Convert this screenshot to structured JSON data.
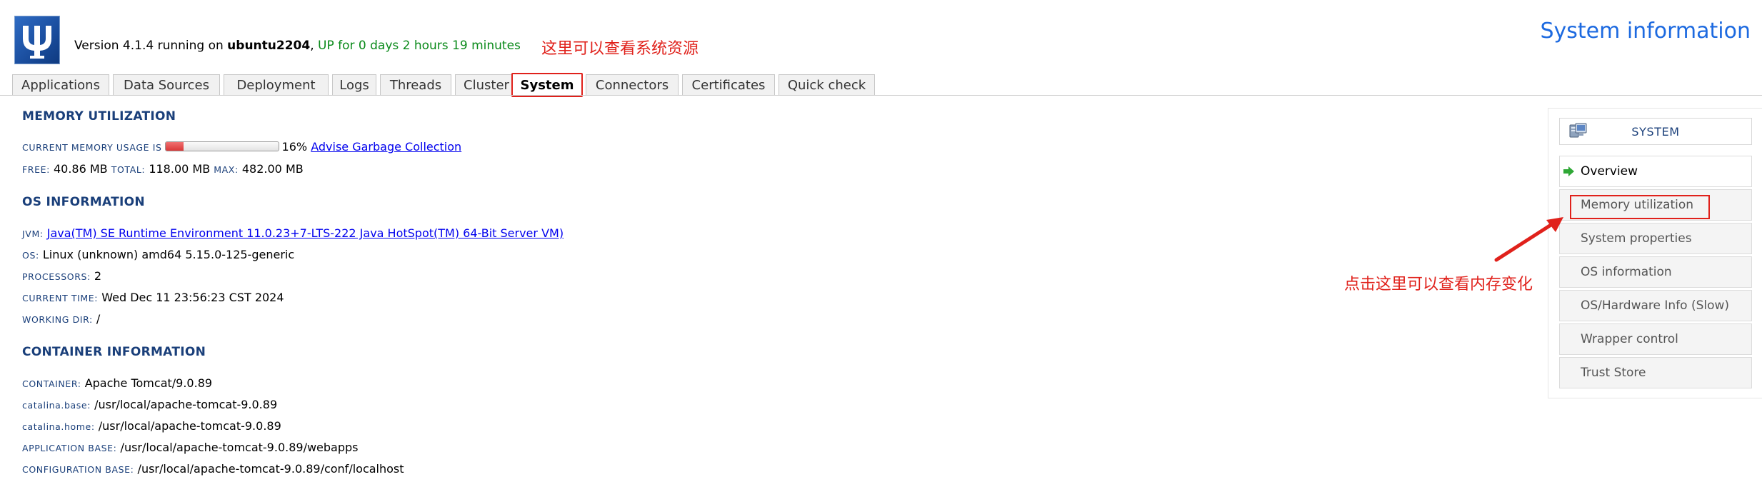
{
  "header": {
    "logo_icon": "psi-logo-icon",
    "version_prefix": "Version 4.1.4 running on ",
    "hostname": "ubuntu2204",
    "version_sep": ", ",
    "uptime": "UP for 0 days 2 hours 19 minutes",
    "page_title": "System information",
    "annotation": "这里可以查看系统资源"
  },
  "tabs": [
    {
      "label": "Applications"
    },
    {
      "label": "Data Sources"
    },
    {
      "label": "Deployment"
    },
    {
      "label": "Logs"
    },
    {
      "label": "Threads"
    },
    {
      "label": "Cluster"
    },
    {
      "label": "System",
      "active": true
    },
    {
      "label": "Connectors"
    },
    {
      "label": "Certificates"
    },
    {
      "label": "Quick check"
    }
  ],
  "memory": {
    "title": "MEMORY UTILIZATION",
    "current_label": "Current memory usage is",
    "percent_text": "16%",
    "percent_value": 0.16,
    "gc_link": "Advise Garbage Collection",
    "free_label": "Free:",
    "free_value": "40.86 MB",
    "total_label": "Total:",
    "total_value": "118.00 MB",
    "max_label": "Max:",
    "max_value": "482.00 MB"
  },
  "os": {
    "title": "OS INFORMATION",
    "jvm_label": "JVM:",
    "jvm_value": " Java(TM) SE Runtime Environment  11.0.23+7-LTS-222  Java HotSpot(TM) 64-Bit Server VM)",
    "os_label": "OS:",
    "os_value": "Linux (unknown) amd64 5.15.0-125-generic",
    "processors_label": "Processors:",
    "processors_value": "2",
    "time_label": "Current time:",
    "time_value": "Wed Dec 11 23:56:23 CST 2024",
    "workdir_label": "Working dir:",
    "workdir_value": "/"
  },
  "container": {
    "title": "CONTAINER INFORMATION",
    "container_label": "Container:",
    "container_value": "Apache Tomcat/9.0.89",
    "cbase_label": "catalina.base:",
    "cbase_value": "/usr/local/apache-tomcat-9.0.89",
    "chome_label": "catalina.home:",
    "chome_value": "/usr/local/apache-tomcat-9.0.89",
    "appbase_label": "Application base:",
    "appbase_value": "/usr/local/apache-tomcat-9.0.89/webapps",
    "confbase_label": "Configuration base:",
    "confbase_value": "/usr/local/apache-tomcat-9.0.89/conf/localhost"
  },
  "sidebar": {
    "header": "SYSTEM",
    "header_icon": "computer-icon",
    "items": [
      {
        "label": "Overview",
        "current": true
      },
      {
        "label": "Memory utilization"
      },
      {
        "label": "System properties"
      },
      {
        "label": "OS information"
      },
      {
        "label": "OS/Hardware Info (Slow)"
      },
      {
        "label": "Wrapper control"
      },
      {
        "label": "Trust Store"
      }
    ],
    "annotation": "点击这里可以查看内存变化"
  },
  "colors": {
    "accent_blue": "#1d6ae0",
    "section_blue": "#1a3f7a",
    "annotation_red": "#e0211b",
    "uptime_green": "#0a8a1a"
  }
}
